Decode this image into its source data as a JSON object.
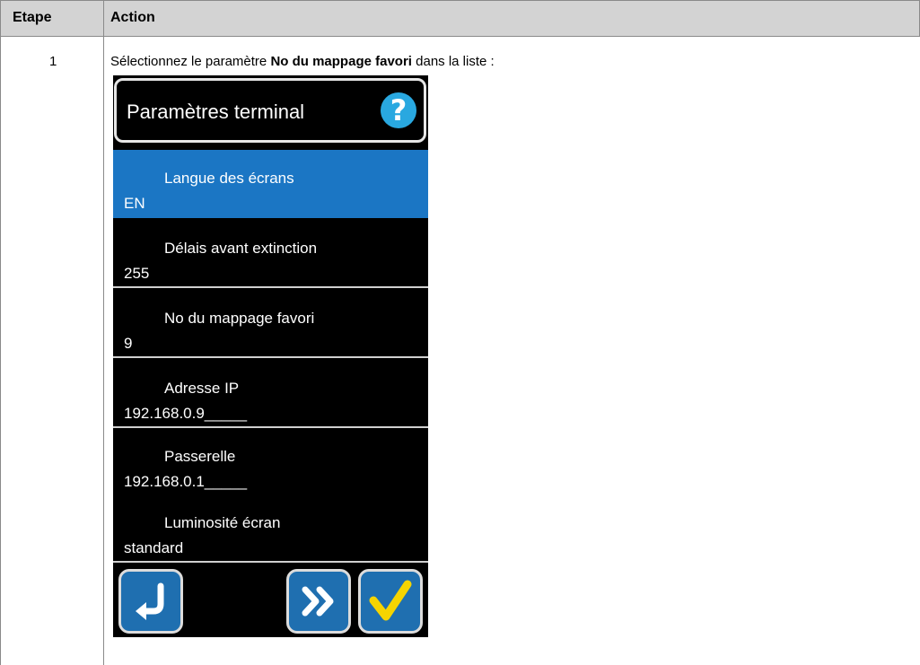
{
  "table": {
    "col_step": "Etape",
    "col_action": "Action"
  },
  "row": {
    "step": "1",
    "instruction_before": "Sélectionnez le paramètre ",
    "instruction_bold": "No du mappage favori",
    "instruction_after": " dans la liste :"
  },
  "screen": {
    "title": "Paramètres terminal",
    "help_icon": "?",
    "items": [
      {
        "label": "Langue des écrans",
        "value": "EN",
        "selected": true
      },
      {
        "label": "Délais avant extinction",
        "value": "255"
      },
      {
        "label": "No du mappage favori",
        "value": "9"
      },
      {
        "label": "Adresse IP",
        "value": "192.168.0.9_____"
      },
      {
        "label": "Passerelle",
        "value": "192.168.0.1_____"
      },
      {
        "label": "Luminosité écran",
        "value": "standard"
      }
    ],
    "buttons": [
      "back-icon",
      "forward-icon",
      "checkmark-icon"
    ]
  },
  "colors": {
    "header_bg": "#d3d3d3",
    "selected_item": "#1b76c4",
    "help_icon": "#29a8e0",
    "button_bg": "#1f6fb0",
    "check": "#f5d400"
  }
}
